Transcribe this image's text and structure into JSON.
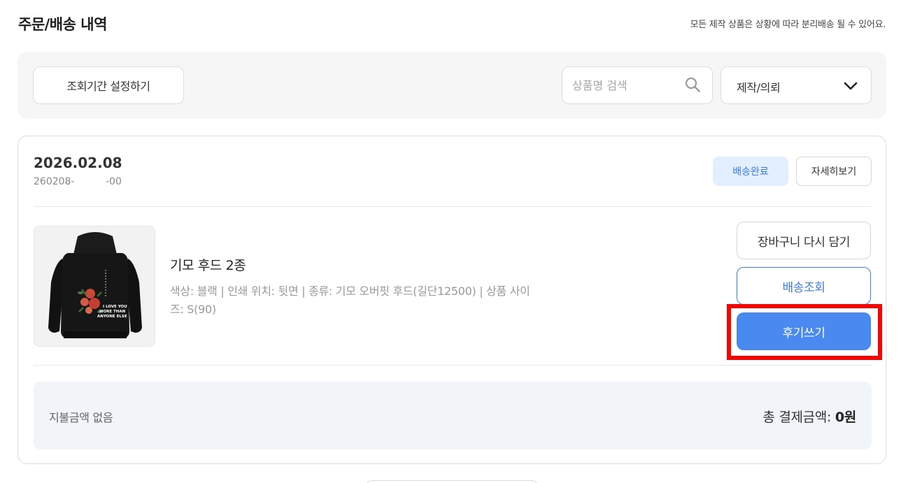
{
  "header": {
    "title": "주문/배송 내역",
    "notice": "모든 제작 상품은 상황에 따라 분리배송 될 수 있어요."
  },
  "filter": {
    "period_button": "조회기간 설정하기",
    "search_placeholder": "상품명 검색",
    "category_selected": "제작/의뢰"
  },
  "order": {
    "date": "2026.02.08",
    "number": "260208-          -00",
    "status": "배송완료",
    "detail_button": "자세히보기",
    "product": {
      "name": "기모 후드 2종",
      "options": "색상: 블랙 | 인쇄 위치: 뒷면 | 종류: 기모 오버핏 후드(길단12500) | 상품 사이즈: S(90)",
      "print_text": "I LOVE YOU MORE THAN ANYONE ELSE"
    },
    "actions": {
      "cart": "장바구니 다시 담기",
      "track": "배송조회",
      "review": "후기쓰기"
    },
    "payment": {
      "note": "지불금액 없음",
      "total_label": "총 결제금액: ",
      "total_value": "0원"
    }
  },
  "colors": {
    "accent": "#4a8af0",
    "badge_bg": "#e3efff",
    "badge_text": "#3b7be6",
    "highlight": "#ff0000"
  }
}
